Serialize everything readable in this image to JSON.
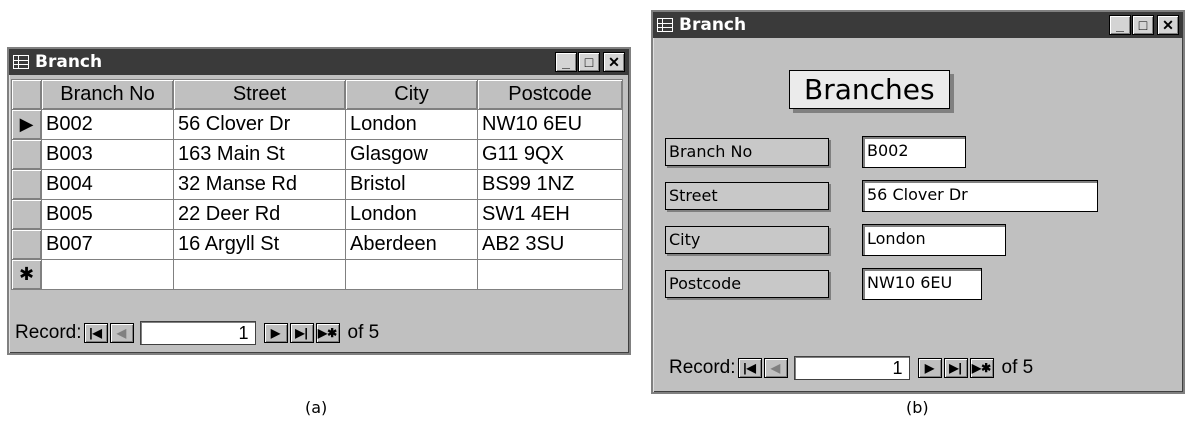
{
  "datasheet_window": {
    "title": "Branch",
    "columns": [
      "Branch No",
      "Street",
      "City",
      "Postcode"
    ],
    "rows": [
      [
        "B002",
        "56 Clover Dr",
        "London",
        "NW10 6EU"
      ],
      [
        "B003",
        "163 Main St",
        "Glasgow",
        "G11 9QX"
      ],
      [
        "B004",
        "32 Manse Rd",
        "Bristol",
        "BS99 1NZ"
      ],
      [
        "B005",
        "22 Deer Rd",
        "London",
        "SW1 4EH"
      ],
      [
        "B007",
        "16 Argyll St",
        "Aberdeen",
        "AB2 3SU"
      ]
    ],
    "current_row_marker": "▶",
    "new_row_marker": "✱",
    "nav": {
      "record_label": "Record:",
      "current": "1",
      "of_label": "of 5"
    }
  },
  "form_window": {
    "title": "Branch",
    "heading": "Branches",
    "fields": [
      {
        "label": "Branch No",
        "value": "B002"
      },
      {
        "label": "Street",
        "value": "56 Clover Dr"
      },
      {
        "label": "City",
        "value": "London"
      },
      {
        "label": "Postcode",
        "value": "NW10 6EU"
      }
    ],
    "nav": {
      "record_label": "Record:",
      "current": "1",
      "of_label": "of 5"
    }
  },
  "window_buttons": {
    "minimize": "_",
    "maximize": "□",
    "close": "✕"
  },
  "nav_buttons": {
    "first": "|◀",
    "prev": "◀",
    "next": "▶",
    "last": "▶|",
    "new": "▶✱"
  },
  "captions": {
    "a": "(a)",
    "b": "(b)"
  }
}
